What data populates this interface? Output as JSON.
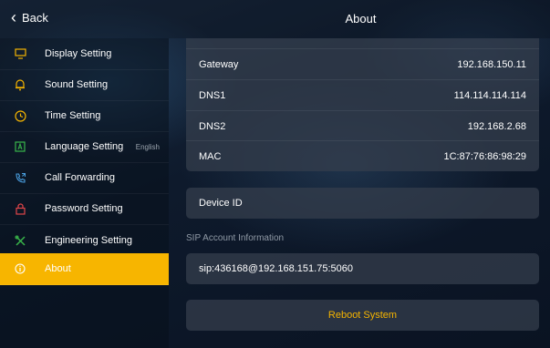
{
  "topbar": {
    "back_label": "Back",
    "title": "About"
  },
  "sidebar": {
    "items": [
      {
        "label": "Display Setting",
        "icon": "monitor-icon",
        "extra": ""
      },
      {
        "label": "Sound Setting",
        "icon": "bell-icon",
        "extra": ""
      },
      {
        "label": "Time Setting",
        "icon": "clock-icon",
        "extra": ""
      },
      {
        "label": "Language Setting",
        "icon": "language-icon",
        "extra": "English"
      },
      {
        "label": "Call Forwarding",
        "icon": "phone-forward-icon",
        "extra": ""
      },
      {
        "label": "Password Setting",
        "icon": "lock-icon",
        "extra": ""
      },
      {
        "label": "Engineering Setting",
        "icon": "tools-icon",
        "extra": ""
      },
      {
        "label": "About",
        "icon": "info-icon",
        "extra": ""
      }
    ],
    "active_index": 7
  },
  "network": {
    "rows": [
      {
        "key": "Gateway",
        "value": "192.168.150.11"
      },
      {
        "key": "DNS1",
        "value": "114.114.114.114"
      },
      {
        "key": "DNS2",
        "value": "192.168.2.68"
      },
      {
        "key": "MAC",
        "value": "1C:87:76:86:98:29"
      }
    ]
  },
  "device": {
    "label": "Device ID",
    "value": ""
  },
  "sip": {
    "section_title": "SIP Account Information",
    "account": "sip:436168@192.168.151.75:5060"
  },
  "actions": {
    "reboot_label": "Reboot System"
  },
  "colors": {
    "accent": "#f7b500"
  }
}
